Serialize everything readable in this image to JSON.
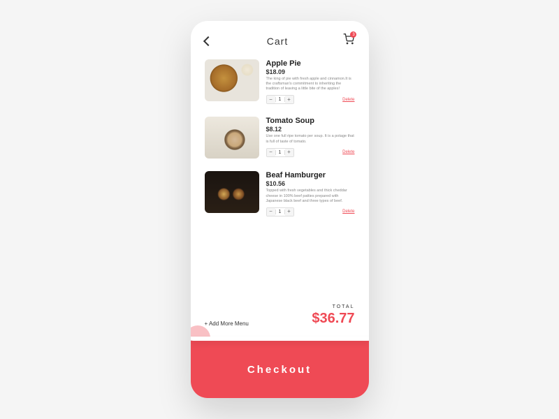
{
  "header": {
    "title": "Cart",
    "cart_badge": "3"
  },
  "items": [
    {
      "name": "Apple Pie",
      "price": "$18.09",
      "desc": "The king of pie with fresh apple and cinnamon.It is the craftsman's commitment to inheriting the tradition of leaving a little bite of the apples!",
      "qty": "1",
      "delete": "Delete"
    },
    {
      "name": "Tomato Soup",
      "price": "$8.12",
      "desc": "Use one full ripe tomato per soup. It is a potage that is full of taste of tomato.",
      "qty": "1",
      "delete": "Delete"
    },
    {
      "name": "Beaf Hamburger",
      "price": "$10.56",
      "desc": "Topped with fresh vegetables and thick cheddar cheese in 100% beef patties prepared with Japanese black beef and three types of beef.",
      "qty": "1",
      "delete": "Delete"
    }
  ],
  "footer": {
    "add_more": "+ Add More Menu",
    "total_label": "TOTAL",
    "total_price": "$36.77"
  },
  "checkout": {
    "label": "Checkout"
  }
}
